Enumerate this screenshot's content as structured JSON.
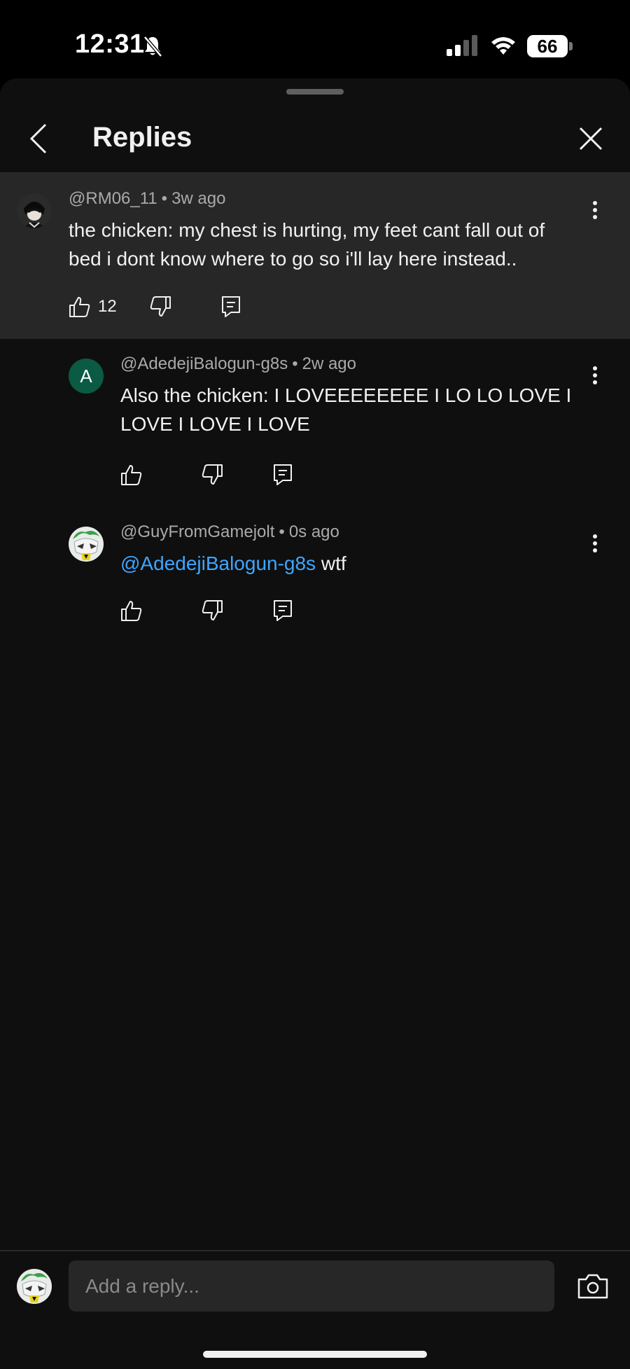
{
  "status_bar": {
    "time": "12:31",
    "battery": "66"
  },
  "header": {
    "title": "Replies"
  },
  "parent_comment": {
    "author": "@RM06_11",
    "separator": "•",
    "age": "3w ago",
    "text": "the chicken: my chest is hurting, my feet cant fall out of bed i dont know where to go so i'll lay here instead..",
    "like_count": "12"
  },
  "replies": [
    {
      "author": "@AdedejiBalogun-g8s",
      "avatar_letter": "A",
      "separator": "•",
      "age": "2w ago",
      "text": "Also the chicken: I LOVEEEEEEEE I LO LO LOVE I LOVE I LOVE I LOVE"
    },
    {
      "author": "@GuyFromGamejolt",
      "separator": "•",
      "age": "0s ago",
      "mention": "@AdedejiBalogun-g8s",
      "text": " wtf"
    }
  ],
  "reply_bar": {
    "placeholder": "Add a reply..."
  },
  "icons": {
    "back": "chevron-left-icon",
    "close": "close-icon",
    "more": "more-vert-icon",
    "like": "thumbs-up-icon",
    "dislike": "thumbs-down-icon",
    "reply": "reply-icon",
    "camera": "camera-icon"
  },
  "colors": {
    "background": "#0f0f0f",
    "highlight": "#272727",
    "mention": "#3ea6ff",
    "meta_text": "#aaaaaa"
  }
}
